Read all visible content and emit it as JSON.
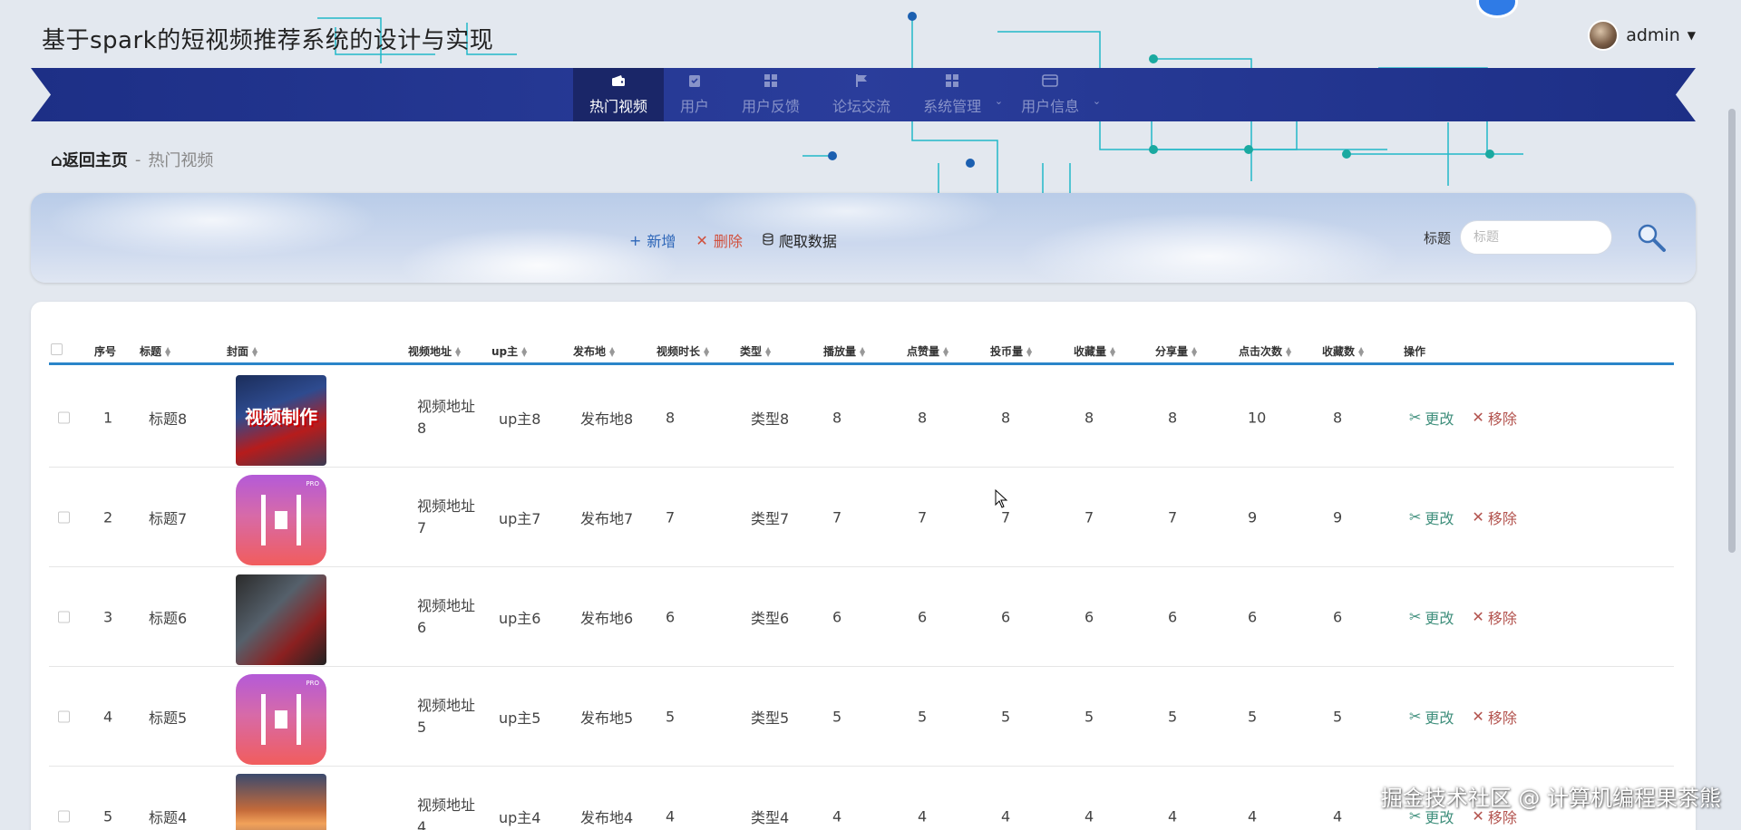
{
  "app": {
    "title": "基于spark的短视频推荐系统的设计与实现"
  },
  "user": {
    "name": "admin"
  },
  "nav": {
    "items": [
      {
        "label": "热门视频",
        "icon": "wallet-icon",
        "active": true
      },
      {
        "label": "用户",
        "icon": "clipboard-icon"
      },
      {
        "label": "用户反馈",
        "icon": "grid-icon"
      },
      {
        "label": "论坛交流",
        "icon": "flag-icon"
      },
      {
        "label": "系统管理",
        "icon": "grid-icon",
        "dropdown": true
      },
      {
        "label": "用户信息",
        "icon": "card-icon",
        "dropdown": true
      }
    ]
  },
  "breadcrumb": {
    "home": "返回主页",
    "separator": "-",
    "current": "热门视频"
  },
  "toolbar": {
    "add": "新增",
    "delete": "删除",
    "crawl": "爬取数据",
    "search_label": "标题",
    "search_placeholder": "标题"
  },
  "table": {
    "headers": {
      "index": "序号",
      "title": "标题",
      "cover": "封面",
      "url": "视频地址",
      "up": "up主",
      "place": "发布地",
      "duration": "视频时长",
      "type": "类型",
      "plays": "播放量",
      "likes": "点赞量",
      "coins": "投币量",
      "favs": "收藏量",
      "shares": "分享量",
      "clicks": "点击次数",
      "favcount": "收藏数",
      "actions": "操作"
    },
    "edit_label": "更改",
    "remove_label": "移除",
    "rows": [
      {
        "index": "1",
        "title": "标题8",
        "cover_text": "视频制作",
        "url1": "视频地址",
        "url2": "8",
        "up": "up主8",
        "place": "发布地8",
        "duration": "8",
        "type": "类型8",
        "plays": "8",
        "likes": "8",
        "coins": "8",
        "favs": "8",
        "shares": "8",
        "clicks": "10",
        "favcount": "8"
      },
      {
        "index": "2",
        "title": "标题7",
        "cover_text": "PRO",
        "url1": "视频地址",
        "url2": "7",
        "up": "up主7",
        "place": "发布地7",
        "duration": "7",
        "type": "类型7",
        "plays": "7",
        "likes": "7",
        "coins": "7",
        "favs": "7",
        "shares": "7",
        "clicks": "9",
        "favcount": "9"
      },
      {
        "index": "3",
        "title": "标题6",
        "cover_text": "",
        "url1": "视频地址",
        "url2": "6",
        "up": "up主6",
        "place": "发布地6",
        "duration": "6",
        "type": "类型6",
        "plays": "6",
        "likes": "6",
        "coins": "6",
        "favs": "6",
        "shares": "6",
        "clicks": "6",
        "favcount": "6"
      },
      {
        "index": "4",
        "title": "标题5",
        "cover_text": "PRO",
        "url1": "视频地址",
        "url2": "5",
        "up": "up主5",
        "place": "发布地5",
        "duration": "5",
        "type": "类型5",
        "plays": "5",
        "likes": "5",
        "coins": "5",
        "favs": "5",
        "shares": "5",
        "clicks": "5",
        "favcount": "5"
      },
      {
        "index": "5",
        "title": "标题4",
        "cover_text": "",
        "url1": "视频地址",
        "url2": "4",
        "up": "up主4",
        "place": "发布地4",
        "duration": "4",
        "type": "类型4",
        "plays": "4",
        "likes": "4",
        "coins": "4",
        "favs": "4",
        "shares": "4",
        "clicks": "4",
        "favcount": "4"
      }
    ]
  },
  "watermark": "掘金技术社区 @ 计算机编程果茶熊",
  "colors": {
    "nav": "#2a3d9b",
    "accent": "#2a85c9",
    "edit": "#3f8f7c",
    "remove": "#b3534e",
    "delete": "#d0503d",
    "add": "#2d66b8"
  }
}
